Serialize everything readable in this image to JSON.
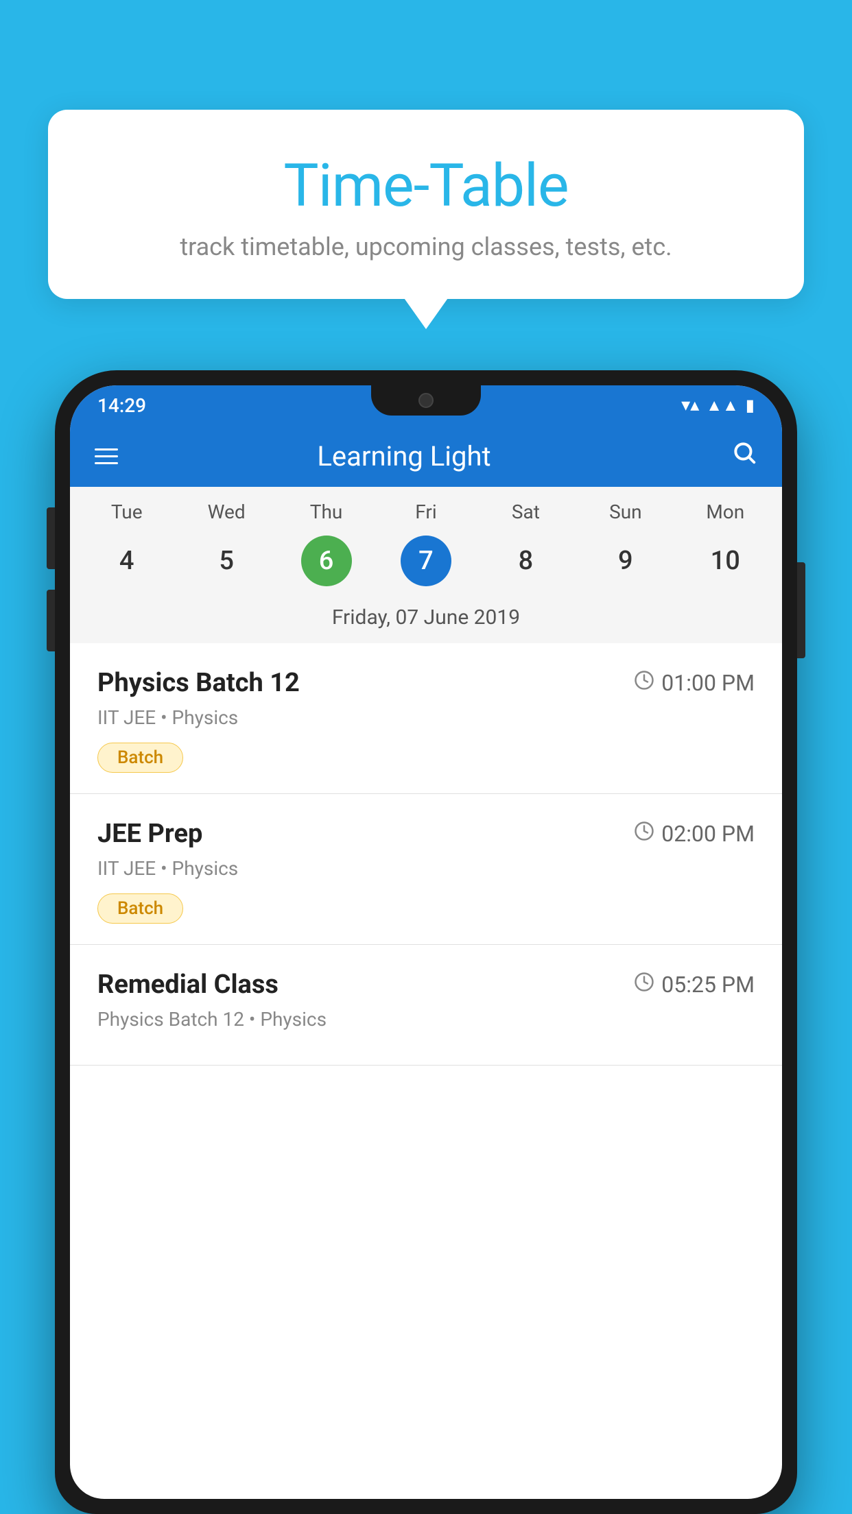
{
  "page": {
    "bg_color": "#29B6E8"
  },
  "tooltip": {
    "title": "Time-Table",
    "subtitle": "track timetable, upcoming classes, tests, etc."
  },
  "status_bar": {
    "time": "14:29"
  },
  "app_bar": {
    "title": "Learning Light"
  },
  "calendar": {
    "days": [
      "Tue",
      "Wed",
      "Thu",
      "Fri",
      "Sat",
      "Sun",
      "Mon"
    ],
    "dates": [
      {
        "num": "4",
        "state": "normal"
      },
      {
        "num": "5",
        "state": "normal"
      },
      {
        "num": "6",
        "state": "today"
      },
      {
        "num": "7",
        "state": "selected"
      },
      {
        "num": "8",
        "state": "normal"
      },
      {
        "num": "9",
        "state": "normal"
      },
      {
        "num": "10",
        "state": "normal"
      }
    ],
    "selected_date": "Friday, 07 June 2019"
  },
  "schedule": {
    "items": [
      {
        "name": "Physics Batch 12",
        "time": "01:00 PM",
        "meta": "IIT JEE • Physics",
        "tag": "Batch"
      },
      {
        "name": "JEE Prep",
        "time": "02:00 PM",
        "meta": "IIT JEE • Physics",
        "tag": "Batch"
      },
      {
        "name": "Remedial Class",
        "time": "05:25 PM",
        "meta": "Physics Batch 12 • Physics",
        "tag": ""
      }
    ]
  }
}
